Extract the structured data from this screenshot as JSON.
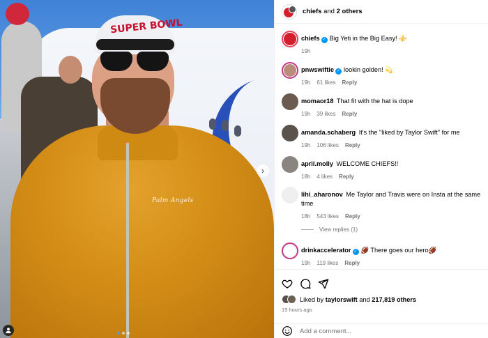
{
  "photo": {
    "hat_text": "SUPER BOWL",
    "jacket_brand": "Palm Angels",
    "next_icon": "›",
    "slide_count": 3,
    "active_slide": 1
  },
  "header": {
    "username": "chiefs",
    "others_text": "and",
    "others_count": "2 others"
  },
  "comments": [
    {
      "user": "chiefs",
      "verified": true,
      "text": "Big Yeti in the Big Easy! ⚜️",
      "time": "19h",
      "likes": "",
      "reply": ""
    },
    {
      "user": "pnwswiftie",
      "verified": true,
      "text": "lookin golden! 💫",
      "time": "19h",
      "likes": "61 likes",
      "reply": "Reply"
    },
    {
      "user": "momaor18",
      "verified": false,
      "text": "That fit with the hat is dope",
      "time": "19h",
      "likes": "39 likes",
      "reply": "Reply"
    },
    {
      "user": "amanda.schaberg",
      "verified": false,
      "text": "It's the \"liked by Taylor Swift\" for me",
      "time": "19h",
      "likes": "106 likes",
      "reply": "Reply"
    },
    {
      "user": "april.molly",
      "verified": false,
      "text": "WELCOME CHIEFS!!",
      "time": "18h",
      "likes": "4 likes",
      "reply": "Reply"
    },
    {
      "user": "lihi_aharonov",
      "verified": false,
      "text": "Me Taylor and Travis were on Insta at the same time",
      "time": "18h",
      "likes": "543 likes",
      "reply": "Reply"
    },
    {
      "user": "drinkaccelerator",
      "verified": true,
      "text": "🏈 There goes our hero🏈",
      "time": "19h",
      "likes": "119 likes",
      "reply": "Reply"
    }
  ],
  "view_replies": "View replies (1)",
  "liked_by": {
    "prefix": "Liked by",
    "user": "taylorswift",
    "middle": "and",
    "count": "217,819 others"
  },
  "time_ago": "19 hours ago",
  "add_comment_placeholder": "Add a comment...",
  "colors": {
    "accent": "#0095f6",
    "jacket": "#d38d16",
    "secondary_text": "#737373"
  }
}
